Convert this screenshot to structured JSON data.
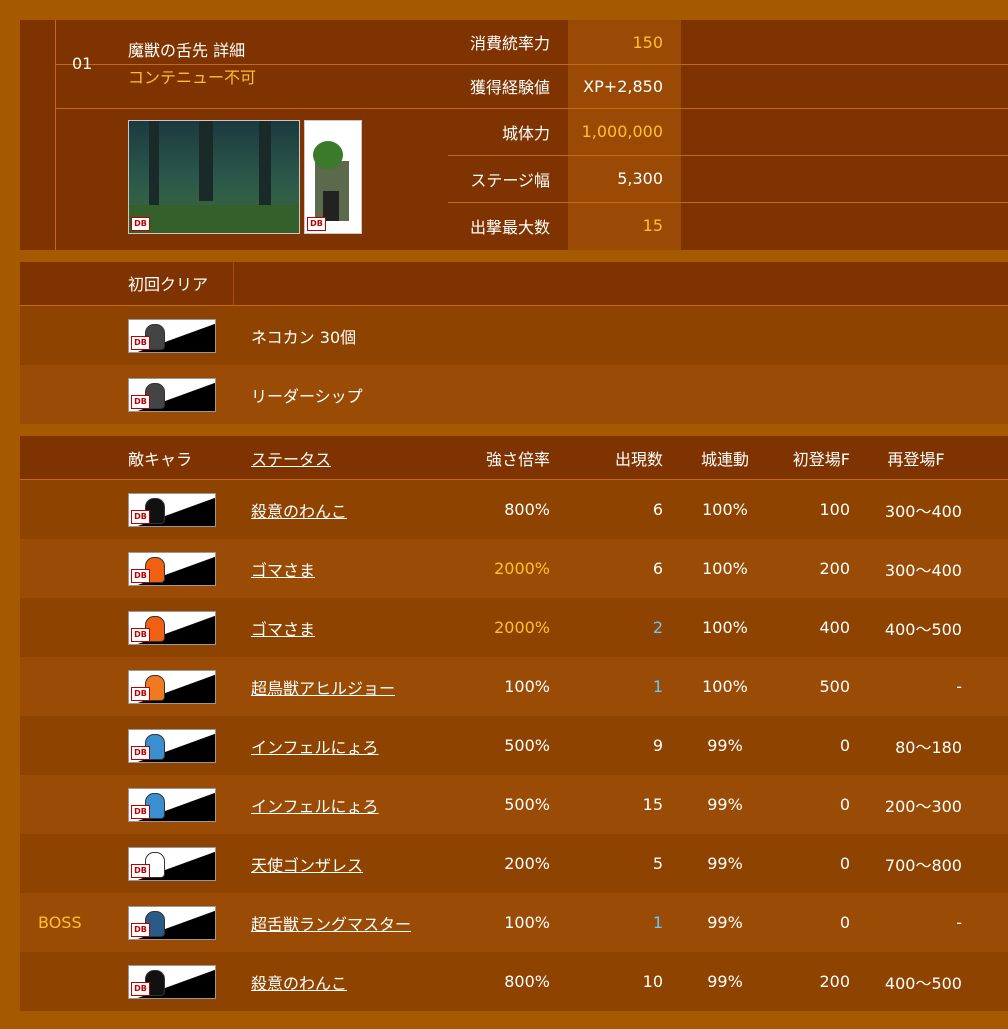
{
  "stage": {
    "number": "01",
    "title": "魔獣の舌先 詳細",
    "note": "コンテニュー不可",
    "stats": [
      {
        "label": "消費統率力",
        "value": "150",
        "highlight": true
      },
      {
        "label": "獲得経験値",
        "value": "XP+2,850",
        "highlight": false
      },
      {
        "label": "城体力",
        "value": "1,000,000",
        "highlight": true
      },
      {
        "label": "ステージ幅",
        "value": "5,300",
        "highlight": false
      },
      {
        "label": "出撃最大数",
        "value": "15",
        "highlight": true
      }
    ],
    "background_badge": "DB",
    "castle_badge": "DB"
  },
  "rewards": {
    "header": "初回クリア",
    "items": [
      {
        "name": "ネコカン 30個",
        "icon": "cat-food-icon",
        "badge": "DB"
      },
      {
        "name": "リーダーシップ",
        "icon": "leadership-icon",
        "badge": "DB"
      }
    ]
  },
  "enemies": {
    "headers": {
      "enemy": "敵キャラ",
      "status": "ステータス",
      "mag": "強さ倍率",
      "count": "出現数",
      "castle": "城連動",
      "first": "初登場F",
      "respawn": "再登場F"
    },
    "rows": [
      {
        "boss": "",
        "name": "殺意のわんこ",
        "mag": "800%",
        "mag_hl": false,
        "count": "6",
        "count_hl": false,
        "castle": "100%",
        "first": "100",
        "respawn": "300〜400",
        "icon": "black-dog-icon",
        "color": "#111111"
      },
      {
        "boss": "",
        "name": "ゴマさま",
        "mag": "2000%",
        "mag_hl": true,
        "count": "6",
        "count_hl": false,
        "castle": "100%",
        "first": "200",
        "respawn": "300〜400",
        "icon": "orange-seal-icon",
        "color": "#f06010"
      },
      {
        "boss": "",
        "name": "ゴマさま",
        "mag": "2000%",
        "mag_hl": true,
        "count": "2",
        "count_hl": true,
        "castle": "100%",
        "first": "400",
        "respawn": "400〜500",
        "icon": "orange-seal-icon",
        "color": "#f06010"
      },
      {
        "boss": "",
        "name": "超鳥獣アヒルジョー",
        "mag": "100%",
        "mag_hl": false,
        "count": "1",
        "count_hl": true,
        "castle": "100%",
        "first": "500",
        "respawn": "-",
        "icon": "orange-duck-icon",
        "color": "#f07a20"
      },
      {
        "boss": "",
        "name": "インフェルにょろ",
        "mag": "500%",
        "mag_hl": false,
        "count": "9",
        "count_hl": false,
        "castle": "99%",
        "first": "0",
        "respawn": "80〜180",
        "icon": "blue-snake-icon",
        "color": "#3a8fd0"
      },
      {
        "boss": "",
        "name": "インフェルにょろ",
        "mag": "500%",
        "mag_hl": false,
        "count": "15",
        "count_hl": false,
        "castle": "99%",
        "first": "0",
        "respawn": "200〜300",
        "icon": "blue-snake-icon",
        "color": "#3a8fd0"
      },
      {
        "boss": "",
        "name": "天使ゴンザレス",
        "mag": "200%",
        "mag_hl": false,
        "count": "5",
        "count_hl": false,
        "castle": "99%",
        "first": "0",
        "respawn": "700〜800",
        "icon": "angel-icon",
        "color": "#ffffff"
      },
      {
        "boss": "BOSS",
        "name": "超舌獣ラングマスター",
        "mag": "100%",
        "mag_hl": false,
        "count": "1",
        "count_hl": true,
        "castle": "99%",
        "first": "0",
        "respawn": "-",
        "icon": "tongue-beast-icon",
        "color": "#2a5a88"
      },
      {
        "boss": "",
        "name": "殺意のわんこ",
        "mag": "800%",
        "mag_hl": false,
        "count": "10",
        "count_hl": false,
        "castle": "99%",
        "first": "200",
        "respawn": "400〜500",
        "icon": "black-dog-icon",
        "color": "#111111"
      }
    ]
  }
}
